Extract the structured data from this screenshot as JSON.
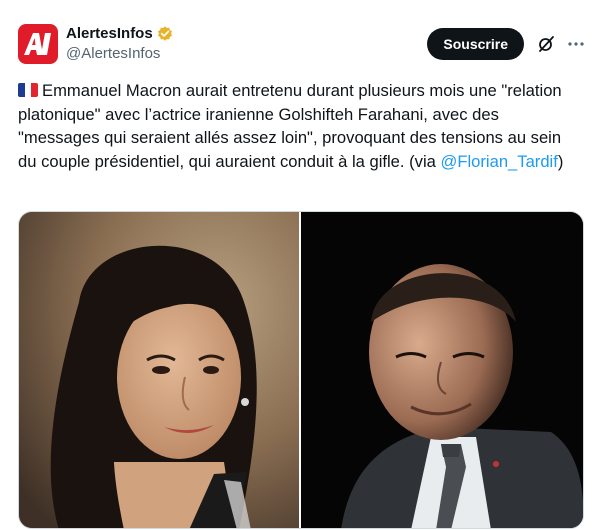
{
  "account": {
    "display_name": "AlertesInfos",
    "handle": "@AlertesInfos",
    "avatar_text": "AI",
    "verified": true
  },
  "actions": {
    "subscribe_label": "Souscrire"
  },
  "tweet": {
    "text": "Emmanuel Macron aurait entretenu durant plusieurs mois une \"relation platonique\" avec l’actrice iranienne Golshifteh Farahani, avec des \"messages qui seraient allés assez loin\", provoquant des tensions au sein du couple présidentiel, qui auraient conduit à la gifle. (via ",
    "mention": "@Florian_Tardif",
    "text_end": ")"
  },
  "colors": {
    "avatar_bg": "#e01b2a",
    "verified_badge": "#e8b32a",
    "mention": "#1d9bf0",
    "subscribe_bg": "#0f1419"
  },
  "media": {
    "left_photo": "woman-portrait-photo",
    "right_photo": "man-portrait-photo"
  }
}
